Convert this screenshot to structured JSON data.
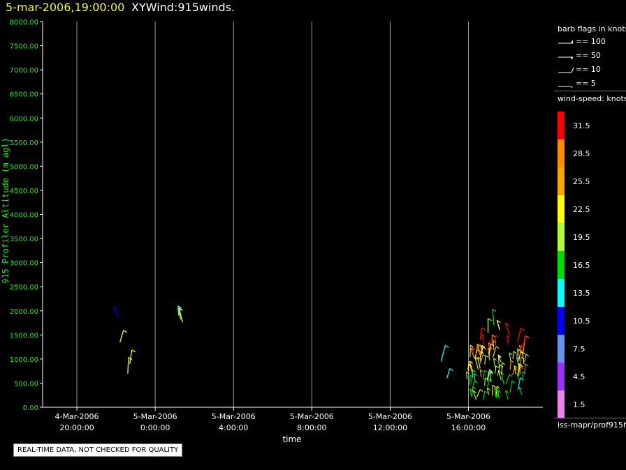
{
  "header": {
    "date": "5-mar-2006,19:00:00",
    "name": "XYWind:915winds."
  },
  "legend": {
    "barb_title": "barb flags in knots",
    "barbs": [
      {
        "label": "== 100",
        "icon": "flag-barb-icon"
      },
      {
        "label": "== 50",
        "icon": "pennant-barb-icon"
      },
      {
        "label": "== 10",
        "icon": "full-barb-icon"
      },
      {
        "label": "== 5",
        "icon": "half-barb-icon"
      }
    ],
    "speed_title": "wind-speed: knots",
    "source": "iss-mapr/prof915h"
  },
  "disclaimer": "REAL-TIME DATA, NOT CHECKED FOR QUALITY",
  "chart_data": {
    "type": "scatter",
    "xlabel": "time",
    "ylabel": "915 Profiler Altitude (m agl)",
    "ylim": [
      0,
      8000
    ],
    "yticks": [
      "0.00",
      "500.00",
      "1000.00",
      "1500.00",
      "2000.00",
      "2500.00",
      "3000.00",
      "3500.00",
      "4000.00",
      "4500.00",
      "5000.00",
      "5500.00",
      "6000.00",
      "6500.00",
      "7000.00",
      "7500.00",
      "8000.00"
    ],
    "xlim_hours": [
      -24.75,
      0.8
    ],
    "xticks": [
      {
        "date": "4-Mar-2006",
        "time": "20:00:00",
        "hour": -23
      },
      {
        "date": "5-Mar-2006",
        "time": "0:00:00",
        "hour": -19
      },
      {
        "date": "5-Mar-2006",
        "time": "4:00:00",
        "hour": -15
      },
      {
        "date": "5-Mar-2006",
        "time": "8:00:00",
        "hour": -11
      },
      {
        "date": "5-Mar-2006",
        "time": "12:00:00",
        "hour": -7
      },
      {
        "date": "5-Mar-2006",
        "time": "16:00:00",
        "hour": -3
      }
    ],
    "colorbar": {
      "levels": [
        "31.5",
        "28.5",
        "25.5",
        "22.5",
        "19.5",
        "16.5",
        "13.5",
        "10.5",
        "7.5",
        "4.5",
        "1.5"
      ],
      "colors": [
        "#ff0000",
        "#ff8c00",
        "#ffa500",
        "#ffff00",
        "#adff2f",
        "#00e000",
        "#00ffff",
        "#0000ff",
        "#6495ed",
        "#9b30ff",
        "#ee82ee"
      ]
    },
    "wind_barbs": [
      {
        "t": -20.9,
        "alt": 1880,
        "speed": 10.5
      },
      {
        "t": -20.8,
        "alt": 1350,
        "speed": 22.5
      },
      {
        "t": -20.3,
        "alt": 900,
        "speed": 22.5
      },
      {
        "t": -20.4,
        "alt": 700,
        "speed": 22.5
      },
      {
        "t": -17.8,
        "alt": 1900,
        "speed": 13.5
      },
      {
        "t": -17.7,
        "alt": 1820,
        "speed": 19.5
      },
      {
        "t": -17.6,
        "alt": 1760,
        "speed": 22.5
      },
      {
        "t": -4.4,
        "alt": 950,
        "speed": 13.5
      },
      {
        "t": -4.1,
        "alt": 600,
        "speed": 13.5
      },
      {
        "t": -2.4,
        "alt": 1400,
        "speed": 31.5
      },
      {
        "t": -2.0,
        "alt": 1550,
        "speed": 19.5
      },
      {
        "t": -1.7,
        "alt": 1700,
        "speed": 16.5
      },
      {
        "t": -1.4,
        "alt": 1600,
        "speed": 22.5
      },
      {
        "t": -0.9,
        "alt": 1500,
        "speed": 31.5
      },
      {
        "t": -0.5,
        "alt": 1350,
        "speed": 31.5
      },
      {
        "t": -0.2,
        "alt": 1150,
        "speed": 28.5
      }
    ]
  }
}
